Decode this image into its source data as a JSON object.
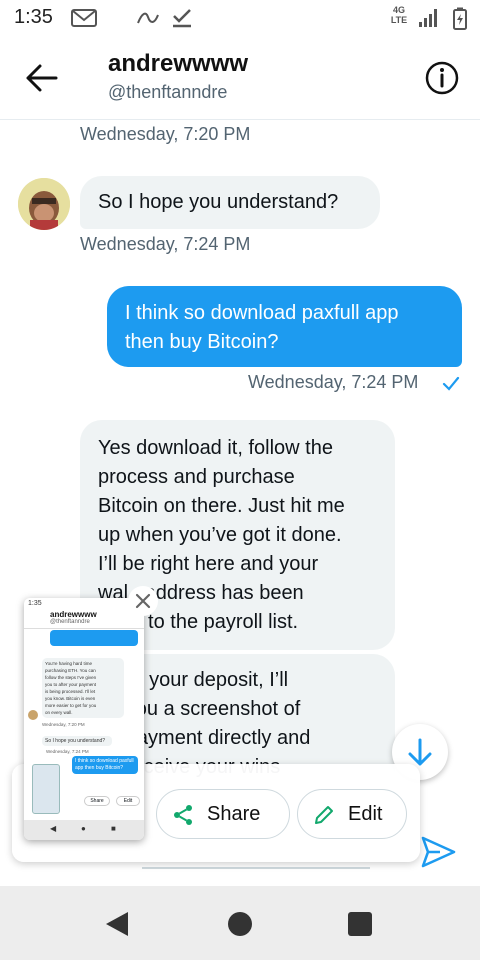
{
  "status_bar": {
    "time": "1:35",
    "network": "4G LTE"
  },
  "header": {
    "name": "andrewwww",
    "handle": "@thenftanndre"
  },
  "messages": [
    {
      "type": "timestamp",
      "text": "Wednesday, 7:20 PM"
    },
    {
      "type": "incoming",
      "text_lines": [
        "So I hope you understand?"
      ]
    },
    {
      "type": "timestamp",
      "text": "Wednesday, 7:24 PM"
    },
    {
      "type": "outgoing",
      "text_lines": [
        "I think so download paxfull app",
        "then buy Bitcoin?"
      ]
    },
    {
      "type": "timestamp",
      "text": "Wednesday, 7:24 PM",
      "read": true
    },
    {
      "type": "incoming",
      "text_lines": [
        "Yes download it, follow the",
        "process and purchase",
        "Bitcoin on there. Just hit me",
        "up when you’ve got it done.",
        "I’ll be right here and your",
        "wal   address has been",
        "    ed to the payroll list."
      ]
    },
    {
      "type": "incoming",
      "text_lines": [
        "   fter your deposit, I’ll",
        "     you a screenshot of",
        "     payment directly and",
        "     receive your wins"
      ]
    }
  ],
  "share_sheet": {
    "share_label": "Share",
    "edit_label": "Edit"
  },
  "thumbnail": {
    "time": "1:35",
    "name": "andrewwww",
    "handle": "@thenftanndre",
    "lines": [
      "You're having hard time",
      "purchasing ETH. You can",
      "follow the steps I've given",
      "you to after your payment",
      "is being processed. I'll let",
      "you know. Bitcoin is even",
      "more easier to get for you",
      "on every wall."
    ],
    "ts1": "Wednesday, 7:20 PM",
    "msg1": "So I hope you understand?",
    "ts2": "Wednesday, 7:24 PM",
    "out1": "I think so download paxfull app then buy Bitcoin?",
    "share_label": "Share",
    "edit_label": "Edit"
  },
  "colors": {
    "accent": "#1d9bf0",
    "bubble_in": "#eff3f4",
    "muted": "#536471"
  }
}
